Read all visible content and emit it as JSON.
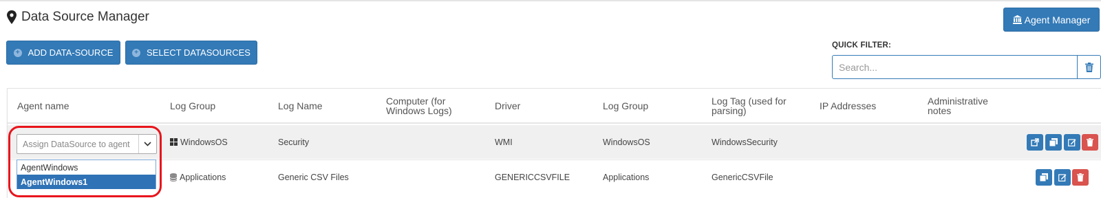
{
  "header": {
    "title": "Data Source Manager",
    "title_icon": "map-pin-icon",
    "agent_manager_label": "Agent Manager",
    "agent_manager_icon": "bank-icon"
  },
  "toolbar": {
    "add_label": "ADD DATA-SOURCE",
    "select_label": "SELECT DATASOURCES"
  },
  "quick_filter": {
    "label": "QUICK FILTER:",
    "placeholder": "Search...",
    "value": ""
  },
  "table": {
    "columns": [
      "Agent name",
      "Log Group",
      "Log Name",
      "Computer (for Windows Logs)",
      "Driver",
      "Log Group",
      "Log Tag (used for parsing)",
      "IP Addresses",
      "Administrative notes"
    ],
    "rows": [
      {
        "agent_placeholder": "Assign DataSource to agent",
        "log_group": "WindowsOS",
        "log_group_icon": "windows-icon",
        "log_name": "Security",
        "computer": "",
        "driver": "WMI",
        "log_group2": "WindowsOS",
        "log_tag": "WindowsSecurity",
        "ip": "",
        "notes": ""
      },
      {
        "agent_placeholder": "",
        "log_group": "Applications",
        "log_group_icon": "database-icon",
        "log_name": "Generic CSV Files",
        "computer": "",
        "driver": "GENERICCSVFILE",
        "log_group2": "Applications",
        "log_tag": "GenericCSVFile",
        "ip": "",
        "notes": ""
      }
    ]
  },
  "agent_dropdown": {
    "options": [
      "AgentWindows",
      "AgentWindows1"
    ],
    "selected_index": 1
  },
  "colors": {
    "primary": "#337ab7",
    "danger": "#d9534f",
    "highlight": "#e8141b",
    "selected_option": "#2f72b6"
  }
}
